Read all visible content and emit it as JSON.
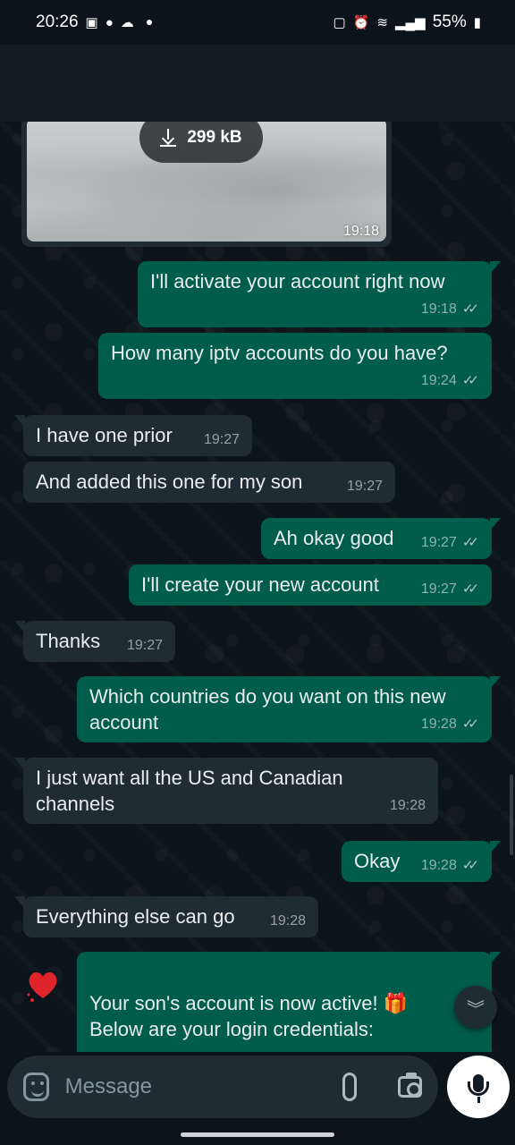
{
  "status_bar": {
    "time": "20:26",
    "left_icons": [
      "gallery-icon",
      "notification-icon",
      "cloud-icon",
      "dot-icon"
    ],
    "right_icons": [
      "battery-saver-icon",
      "alarm-icon",
      "wifi-icon",
      "signal-icon"
    ],
    "battery": "55%"
  },
  "media": {
    "download_size": "299 kB",
    "time": "19:18"
  },
  "messages": [
    {
      "id": "m1",
      "dir": "out",
      "text": "I'll activate your account right now",
      "time": "19:18",
      "status": "read"
    },
    {
      "id": "m2",
      "dir": "out",
      "text": "How many iptv accounts do you have?",
      "time": "19:24",
      "status": "read"
    },
    {
      "id": "m3",
      "dir": "in",
      "text": "I have one prior",
      "time": "19:27"
    },
    {
      "id": "m4",
      "dir": "in",
      "text": "And added this one for my son",
      "time": "19:27"
    },
    {
      "id": "m5",
      "dir": "out",
      "text": "Ah okay good",
      "time": "19:27",
      "status": "read"
    },
    {
      "id": "m6",
      "dir": "out",
      "text": "I'll create your new account",
      "time": "19:27",
      "status": "read"
    },
    {
      "id": "m7",
      "dir": "in",
      "text": "Thanks",
      "time": "19:27"
    },
    {
      "id": "m8",
      "dir": "out",
      "text": "Which countries do you want on this new account",
      "time": "19:28",
      "status": "read"
    },
    {
      "id": "m9",
      "dir": "in",
      "text": "I just want all the US and Canadian channels",
      "time": "19:28"
    },
    {
      "id": "m10",
      "dir": "out",
      "text": "Okay",
      "time": "19:28",
      "status": "read"
    },
    {
      "id": "m11",
      "dir": "in",
      "text": "Everything else can go",
      "time": "19:28"
    },
    {
      "id": "m12",
      "dir": "out",
      "text": "Your son's account is now active! 🎁\nBelow are your login credentials:",
      "time": "",
      "status": ""
    }
  ],
  "input": {
    "placeholder": "Message"
  },
  "colors": {
    "background": "#0b141a",
    "incoming_bubble": "#1f2c34",
    "outgoing_bubble": "#005c4b",
    "text": "#e9edef",
    "meta": "#8696a0"
  }
}
